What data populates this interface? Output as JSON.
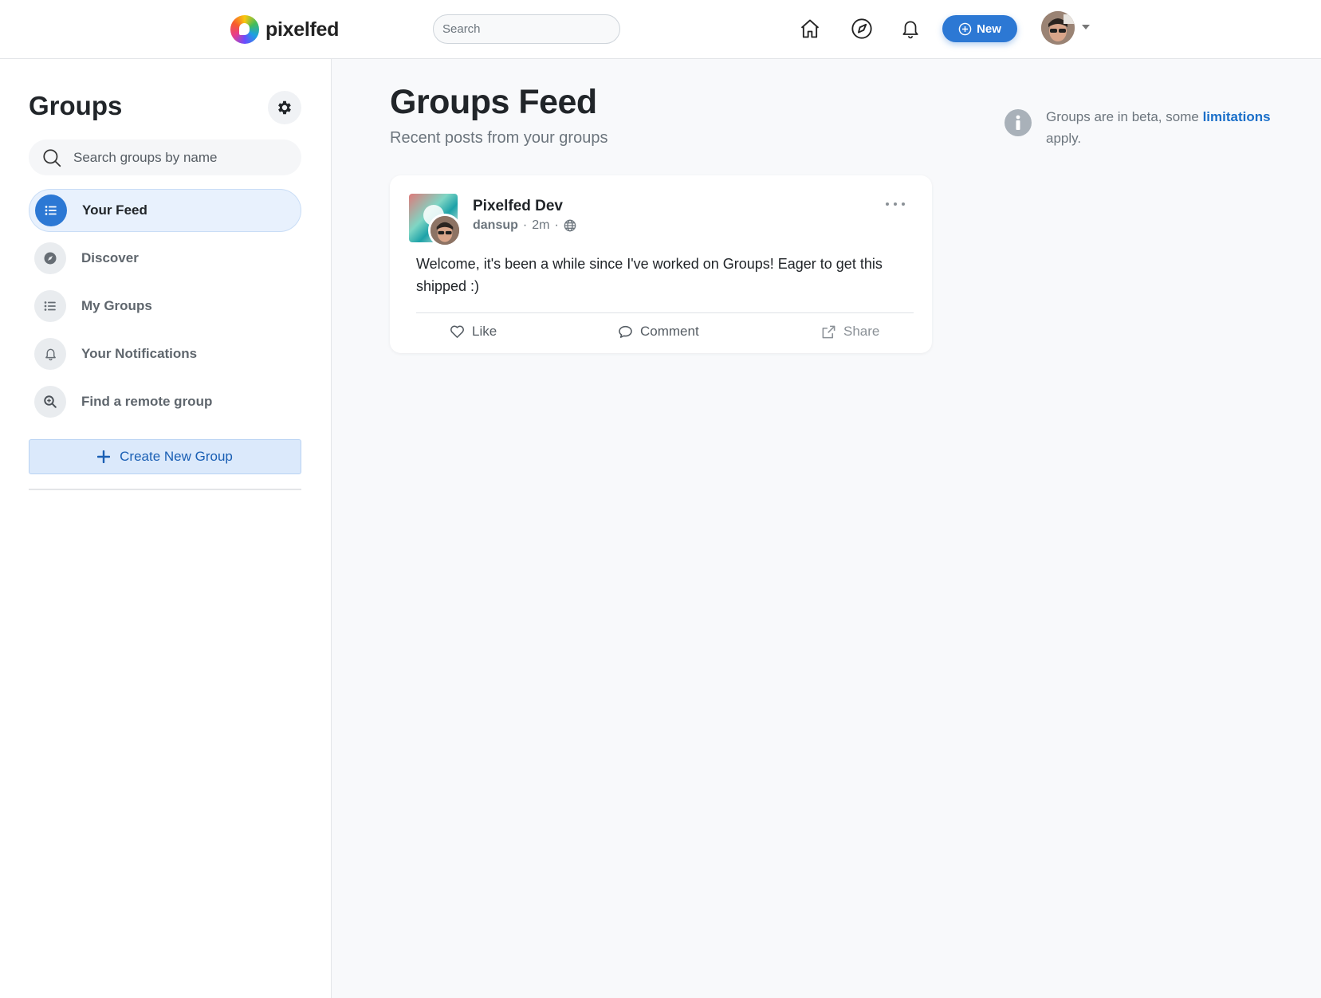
{
  "brand": {
    "name": "pixelfed"
  },
  "topnav": {
    "search_placeholder": "Search",
    "new_label": "New"
  },
  "sidebar": {
    "title": "Groups",
    "search_placeholder": "Search groups by name",
    "items": [
      {
        "label": "Your Feed",
        "icon": "list-icon",
        "active": true
      },
      {
        "label": "Discover",
        "icon": "compass-icon",
        "active": false
      },
      {
        "label": "My Groups",
        "icon": "list-icon",
        "active": false
      },
      {
        "label": "Your Notifications",
        "icon": "bell-icon",
        "active": false
      },
      {
        "label": "Find a remote group",
        "icon": "search-plus-icon",
        "active": false
      }
    ],
    "create_label": "Create New Group"
  },
  "main": {
    "title": "Groups Feed",
    "subtitle": "Recent posts from your groups",
    "beta_text": "Groups are in beta, some",
    "beta_link": "limitations",
    "beta_suffix": "apply."
  },
  "post": {
    "group_name": "Pixelfed Dev",
    "username": "dansup",
    "time": "2m",
    "visibility_icon": "globe-icon",
    "body": "Welcome, it's been a while since I've worked on Groups! Eager to get this shipped :)",
    "actions": {
      "like": "Like",
      "comment": "Comment",
      "share": "Share"
    }
  },
  "colors": {
    "accent": "#2c78d4",
    "link": "#1a6fc9",
    "muted": "#6c757d"
  }
}
